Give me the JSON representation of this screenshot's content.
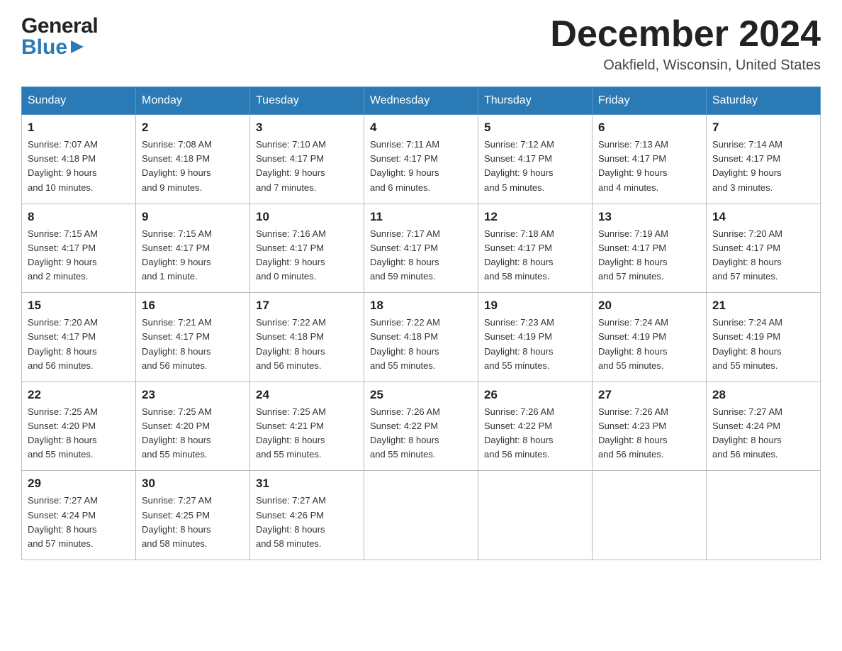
{
  "header": {
    "logo_line1": "General",
    "logo_line2": "Blue",
    "title": "December 2024",
    "location": "Oakfield, Wisconsin, United States"
  },
  "days_of_week": [
    "Sunday",
    "Monday",
    "Tuesday",
    "Wednesday",
    "Thursday",
    "Friday",
    "Saturday"
  ],
  "weeks": [
    [
      {
        "day": "1",
        "info": "Sunrise: 7:07 AM\nSunset: 4:18 PM\nDaylight: 9 hours\nand 10 minutes."
      },
      {
        "day": "2",
        "info": "Sunrise: 7:08 AM\nSunset: 4:18 PM\nDaylight: 9 hours\nand 9 minutes."
      },
      {
        "day": "3",
        "info": "Sunrise: 7:10 AM\nSunset: 4:17 PM\nDaylight: 9 hours\nand 7 minutes."
      },
      {
        "day": "4",
        "info": "Sunrise: 7:11 AM\nSunset: 4:17 PM\nDaylight: 9 hours\nand 6 minutes."
      },
      {
        "day": "5",
        "info": "Sunrise: 7:12 AM\nSunset: 4:17 PM\nDaylight: 9 hours\nand 5 minutes."
      },
      {
        "day": "6",
        "info": "Sunrise: 7:13 AM\nSunset: 4:17 PM\nDaylight: 9 hours\nand 4 minutes."
      },
      {
        "day": "7",
        "info": "Sunrise: 7:14 AM\nSunset: 4:17 PM\nDaylight: 9 hours\nand 3 minutes."
      }
    ],
    [
      {
        "day": "8",
        "info": "Sunrise: 7:15 AM\nSunset: 4:17 PM\nDaylight: 9 hours\nand 2 minutes."
      },
      {
        "day": "9",
        "info": "Sunrise: 7:15 AM\nSunset: 4:17 PM\nDaylight: 9 hours\nand 1 minute."
      },
      {
        "day": "10",
        "info": "Sunrise: 7:16 AM\nSunset: 4:17 PM\nDaylight: 9 hours\nand 0 minutes."
      },
      {
        "day": "11",
        "info": "Sunrise: 7:17 AM\nSunset: 4:17 PM\nDaylight: 8 hours\nand 59 minutes."
      },
      {
        "day": "12",
        "info": "Sunrise: 7:18 AM\nSunset: 4:17 PM\nDaylight: 8 hours\nand 58 minutes."
      },
      {
        "day": "13",
        "info": "Sunrise: 7:19 AM\nSunset: 4:17 PM\nDaylight: 8 hours\nand 57 minutes."
      },
      {
        "day": "14",
        "info": "Sunrise: 7:20 AM\nSunset: 4:17 PM\nDaylight: 8 hours\nand 57 minutes."
      }
    ],
    [
      {
        "day": "15",
        "info": "Sunrise: 7:20 AM\nSunset: 4:17 PM\nDaylight: 8 hours\nand 56 minutes."
      },
      {
        "day": "16",
        "info": "Sunrise: 7:21 AM\nSunset: 4:17 PM\nDaylight: 8 hours\nand 56 minutes."
      },
      {
        "day": "17",
        "info": "Sunrise: 7:22 AM\nSunset: 4:18 PM\nDaylight: 8 hours\nand 56 minutes."
      },
      {
        "day": "18",
        "info": "Sunrise: 7:22 AM\nSunset: 4:18 PM\nDaylight: 8 hours\nand 55 minutes."
      },
      {
        "day": "19",
        "info": "Sunrise: 7:23 AM\nSunset: 4:19 PM\nDaylight: 8 hours\nand 55 minutes."
      },
      {
        "day": "20",
        "info": "Sunrise: 7:24 AM\nSunset: 4:19 PM\nDaylight: 8 hours\nand 55 minutes."
      },
      {
        "day": "21",
        "info": "Sunrise: 7:24 AM\nSunset: 4:19 PM\nDaylight: 8 hours\nand 55 minutes."
      }
    ],
    [
      {
        "day": "22",
        "info": "Sunrise: 7:25 AM\nSunset: 4:20 PM\nDaylight: 8 hours\nand 55 minutes."
      },
      {
        "day": "23",
        "info": "Sunrise: 7:25 AM\nSunset: 4:20 PM\nDaylight: 8 hours\nand 55 minutes."
      },
      {
        "day": "24",
        "info": "Sunrise: 7:25 AM\nSunset: 4:21 PM\nDaylight: 8 hours\nand 55 minutes."
      },
      {
        "day": "25",
        "info": "Sunrise: 7:26 AM\nSunset: 4:22 PM\nDaylight: 8 hours\nand 55 minutes."
      },
      {
        "day": "26",
        "info": "Sunrise: 7:26 AM\nSunset: 4:22 PM\nDaylight: 8 hours\nand 56 minutes."
      },
      {
        "day": "27",
        "info": "Sunrise: 7:26 AM\nSunset: 4:23 PM\nDaylight: 8 hours\nand 56 minutes."
      },
      {
        "day": "28",
        "info": "Sunrise: 7:27 AM\nSunset: 4:24 PM\nDaylight: 8 hours\nand 56 minutes."
      }
    ],
    [
      {
        "day": "29",
        "info": "Sunrise: 7:27 AM\nSunset: 4:24 PM\nDaylight: 8 hours\nand 57 minutes."
      },
      {
        "day": "30",
        "info": "Sunrise: 7:27 AM\nSunset: 4:25 PM\nDaylight: 8 hours\nand 58 minutes."
      },
      {
        "day": "31",
        "info": "Sunrise: 7:27 AM\nSunset: 4:26 PM\nDaylight: 8 hours\nand 58 minutes."
      },
      {
        "day": "",
        "info": ""
      },
      {
        "day": "",
        "info": ""
      },
      {
        "day": "",
        "info": ""
      },
      {
        "day": "",
        "info": ""
      }
    ]
  ]
}
